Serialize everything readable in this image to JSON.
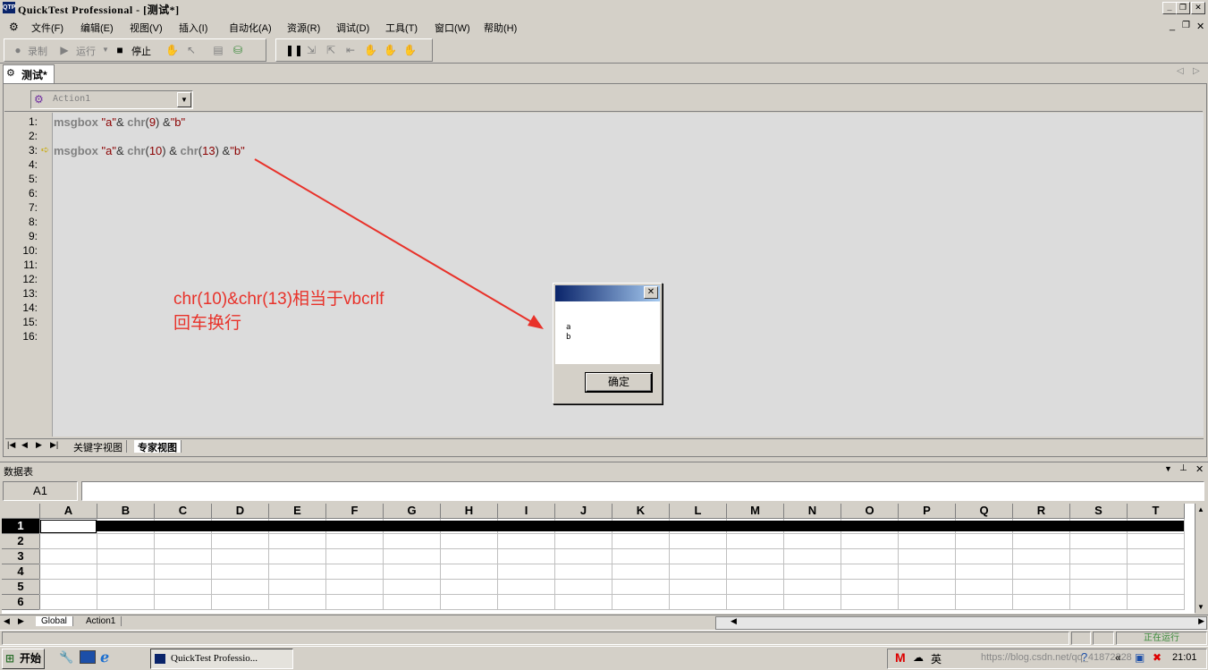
{
  "window": {
    "title": "QuickTest Professional - [测试*]",
    "icon_label": "QTP"
  },
  "menubar": {
    "items": [
      "文件(F)",
      "编辑(E)",
      "视图(V)",
      "插入(I)",
      "自动化(A)",
      "资源(R)",
      "调试(D)",
      "工具(T)",
      "窗口(W)",
      "帮助(H)"
    ]
  },
  "toolbar": {
    "record_label": "录制",
    "run_label": "运行",
    "stop_label": "停止"
  },
  "document_tab": {
    "label": "测试*"
  },
  "editor": {
    "action_combo": "Action1",
    "line_numbers": [
      "1:",
      "2:",
      "3:",
      "4:",
      "5:",
      "6:",
      "7:",
      "8:",
      "9:",
      "10:",
      "11:",
      "12:",
      "13:",
      "14:",
      "15:",
      "16:"
    ],
    "line1": {
      "kw": "msgbox",
      "s1": "\"a\"",
      "op1": "& ",
      "fn1": "chr",
      "p1": "(",
      "n1": "9",
      "p2": ")",
      "op2": " &",
      "s2": "\"b\""
    },
    "line3": {
      "kw": "msgbox",
      "s1": "\"a\"",
      "op1": "& ",
      "fn1": "chr",
      "p1": "(",
      "n1": "10",
      "p2": ")",
      "op2": " & ",
      "fn2": "chr",
      "p3": "(",
      "n2": "13",
      "p4": ")",
      "op3": " &",
      "s2": "\"b\""
    },
    "view_tabs": [
      "关键字视图",
      "专家视图"
    ]
  },
  "annotation": {
    "line1": "chr(10)&chr(13)相当于vbcrlf",
    "line2": "回车换行"
  },
  "dialog": {
    "message_line1": "a",
    "message_line2": "b",
    "ok_label": "确定"
  },
  "data_table": {
    "title": "数据表",
    "cell_ref": "A1",
    "columns": [
      "A",
      "B",
      "C",
      "D",
      "E",
      "F",
      "G",
      "H",
      "I",
      "J",
      "K",
      "L",
      "M",
      "N",
      "O",
      "P",
      "Q",
      "R",
      "S",
      "T"
    ],
    "rows": [
      "1",
      "2",
      "3",
      "4",
      "5",
      "6"
    ],
    "sheet_tabs": [
      "Global",
      "Action1"
    ]
  },
  "statusbar": {
    "status_text": "正在运行"
  },
  "taskbar": {
    "start_label": "开始",
    "task_label": "QuickTest Professio...",
    "clock": "21:01",
    "watermark": "https://blog.csdn.net/qq_41872328"
  },
  "colors": {
    "annotation": "#e8322a",
    "title_gradient_start": "#0a246a",
    "string_literal": "#8b0000"
  }
}
